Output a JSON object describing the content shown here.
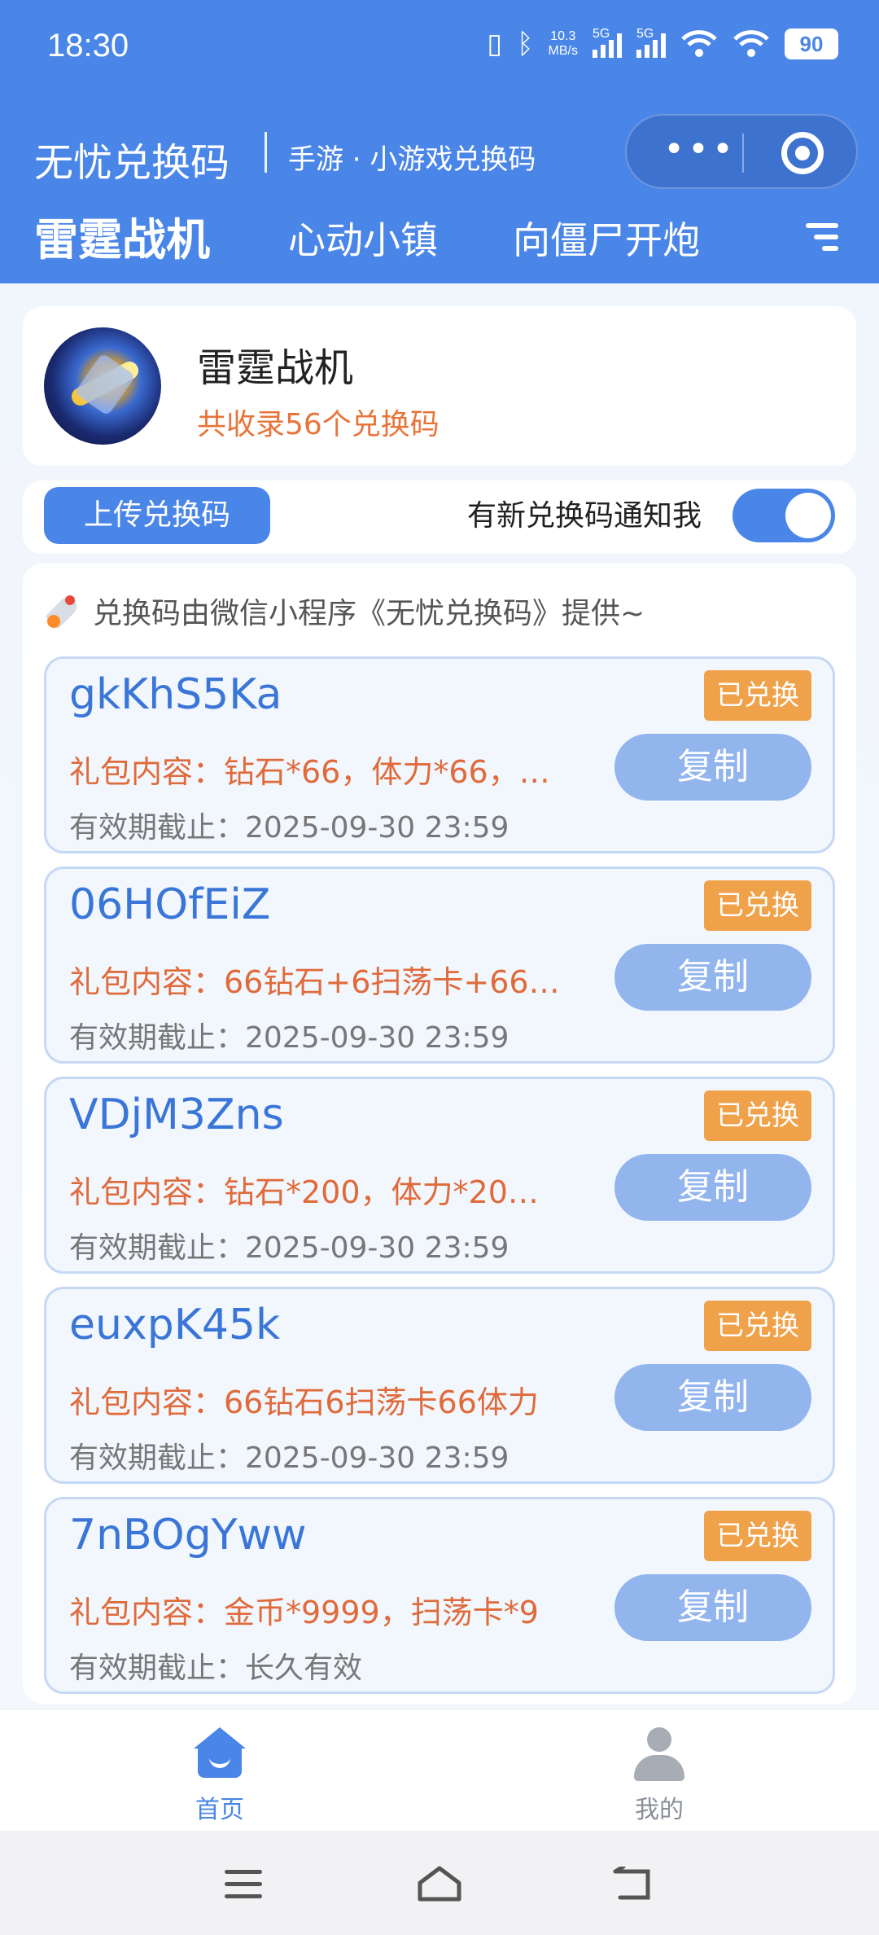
{
  "status_bar": {
    "time": "18:30",
    "net_speed_value": "10.3",
    "net_speed_unit": "MB/s",
    "sim1": "5G",
    "sim2": "5G",
    "battery": "90"
  },
  "app": {
    "title": "无忧兑换码",
    "subtitle": "手游 · 小游戏兑换码",
    "capsule_more": "•••"
  },
  "tabs": [
    {
      "label": "雷霆战机",
      "active": true
    },
    {
      "label": "心动小镇",
      "active": false
    },
    {
      "label": "向僵尸开炮",
      "active": false
    }
  ],
  "game": {
    "name": "雷霆战机",
    "count_text": "共收录56个兑换码"
  },
  "actions": {
    "upload_label": "上传兑换码",
    "notify_label": "有新兑换码通知我",
    "notify_enabled": true
  },
  "provider_text": "兑换码由微信小程序《无忧兑换码》提供~",
  "codes": [
    {
      "code": "gkKhS5Ka",
      "badge": "已兑换",
      "gift": "礼包内容：钻石*66，体力*66，…",
      "copy": "复制",
      "expiry": "有效期截止：2025-09-30 23:59"
    },
    {
      "code": "06HOfEiZ",
      "badge": "已兑换",
      "gift": "礼包内容：66钻石+6扫荡卡+66…",
      "copy": "复制",
      "expiry": "有效期截止：2025-09-30 23:59"
    },
    {
      "code": "VDjM3Zns",
      "badge": "已兑换",
      "gift": "礼包内容：钻石*200，体力*20…",
      "copy": "复制",
      "expiry": "有效期截止：2025-09-30 23:59"
    },
    {
      "code": "euxpK45k",
      "badge": "已兑换",
      "gift": "礼包内容：66钻石6扫荡卡66体力",
      "copy": "复制",
      "expiry": "有效期截止：2025-09-30 23:59"
    },
    {
      "code": "7nBOgYww",
      "badge": "已兑换",
      "gift": "礼包内容：金币*9999，扫荡卡*9",
      "copy": "复制",
      "expiry": "有效期截止：长久有效"
    }
  ],
  "bottom_nav": [
    {
      "label": "首页",
      "icon": "home-icon",
      "active": true,
      "color": "#4a85e8"
    },
    {
      "label": "我的",
      "icon": "user-icon",
      "active": false,
      "color": "#8a8f98"
    }
  ],
  "colors": {
    "primary": "#4a85e8",
    "accent_orange": "#e06a3a",
    "badge": "#f0a24a"
  }
}
